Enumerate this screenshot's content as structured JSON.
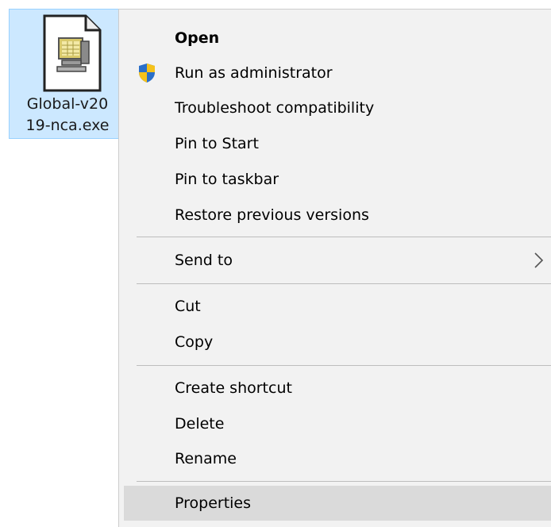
{
  "file": {
    "name_line1": "Global-v20",
    "name_line2": "19-nca.exe",
    "icon": "executable-file-icon"
  },
  "context_menu": {
    "items": [
      {
        "label": "Open",
        "bold": true
      },
      {
        "label": "Run as administrator",
        "icon": "uac-shield-icon"
      },
      {
        "label": "Troubleshoot compatibility"
      },
      {
        "label": "Pin to Start"
      },
      {
        "label": "Pin to taskbar"
      },
      {
        "label": "Restore previous versions"
      },
      {
        "label": "Send to",
        "submenu": true,
        "icon": "chevron-right-icon"
      },
      {
        "label": "Cut"
      },
      {
        "label": "Copy"
      },
      {
        "label": "Create shortcut"
      },
      {
        "label": "Delete"
      },
      {
        "label": "Rename"
      },
      {
        "label": "Properties",
        "hovered": true
      }
    ]
  },
  "colors": {
    "selection_fill": "#cce8ff",
    "menu_background": "#f2f2f2",
    "hover_highlight": "#dadada",
    "shield_blue": "#2a6fc9",
    "shield_yellow": "#f5c21a"
  }
}
